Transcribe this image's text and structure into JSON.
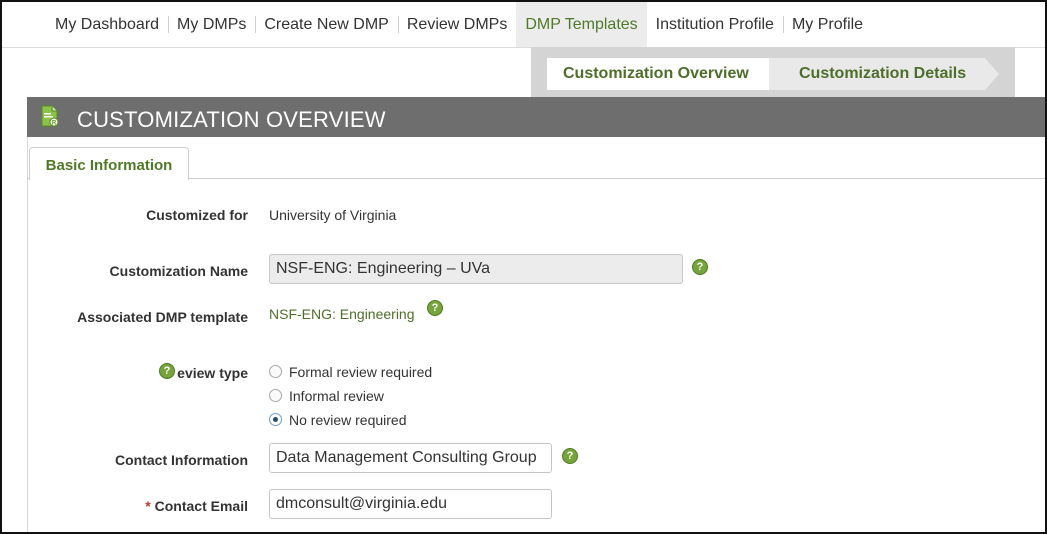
{
  "nav": {
    "items": [
      {
        "label": "My Dashboard"
      },
      {
        "label": "My DMPs"
      },
      {
        "label": "Create New DMP"
      },
      {
        "label": "Review DMPs"
      },
      {
        "label": "DMP Templates",
        "active": true
      },
      {
        "label": "Institution Profile"
      },
      {
        "label": "My Profile"
      }
    ]
  },
  "breadcrumb": {
    "step1": "Customization Overview",
    "step2": "Customization Details"
  },
  "header": {
    "title": "CUSTOMIZATION OVERVIEW",
    "icon": "document-icon"
  },
  "tab": {
    "label": "Basic Information"
  },
  "form": {
    "customized_for": {
      "label": "Customized for",
      "value": "University of Virginia"
    },
    "customization_name": {
      "label": "Customization Name",
      "value": "NSF-ENG: Engineering – UVa"
    },
    "associated_template": {
      "label": "Associated DMP template",
      "value": "NSF-ENG: Engineering"
    },
    "review_type": {
      "label": "eview type",
      "options": [
        {
          "label": "Formal review required",
          "checked": false
        },
        {
          "label": "Informal review",
          "checked": false
        },
        {
          "label": "No review required",
          "checked": true
        }
      ]
    },
    "contact_information": {
      "label": "Contact Information",
      "value": "Data Management Consulting Group"
    },
    "contact_email": {
      "label": "Contact Email",
      "required_marker": "*",
      "value": "dmconsult@virginia.edu"
    }
  },
  "colors": {
    "accent_green": "#4f7a28",
    "header_gray": "#6e6e6e"
  }
}
